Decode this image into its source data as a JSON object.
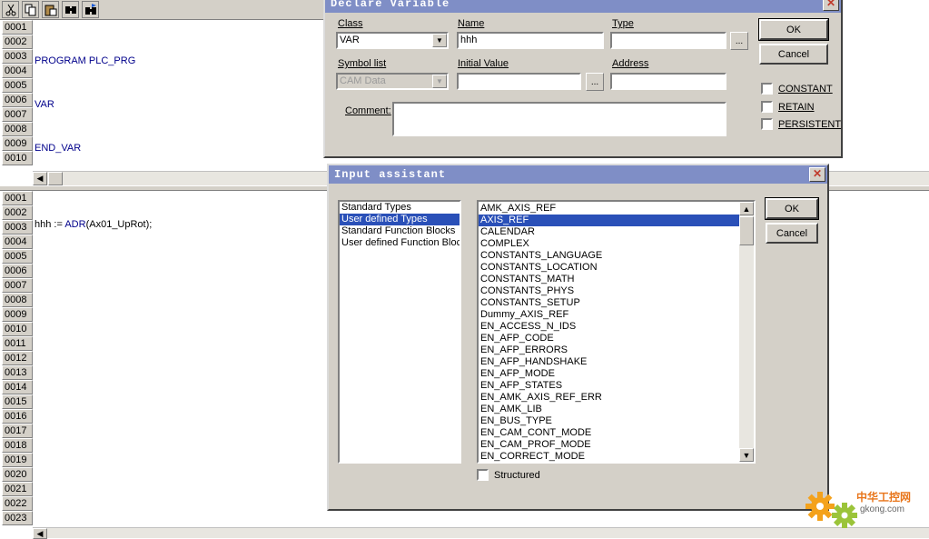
{
  "toolbar": {
    "icons": [
      "cut-icon",
      "copy-icon",
      "paste-icon",
      "find-icon",
      "find-next-icon"
    ]
  },
  "declaration": {
    "line_numbers": [
      "0001",
      "0002",
      "0003",
      "0004",
      "0005",
      "0006",
      "0007",
      "0008",
      "0009",
      "0010"
    ],
    "lines": [
      {
        "kw": "PROGRAM",
        "rest": " PLC_PRG"
      },
      {
        "kw": "VAR",
        "rest": ""
      },
      {
        "kw": "END_VAR",
        "rest": ""
      }
    ]
  },
  "body": {
    "line_numbers": [
      "0001",
      "0002",
      "0003",
      "0004",
      "0005",
      "0006",
      "0007",
      "0008",
      "0009",
      "0010",
      "0011",
      "0012",
      "0013",
      "0014",
      "0015",
      "0016",
      "0017",
      "0018",
      "0019",
      "0020",
      "0021",
      "0022",
      "0023"
    ],
    "code_pre": "hhh := ",
    "code_fn": "ADR",
    "code_post": "(Ax01_UpRot);"
  },
  "declare_dialog": {
    "title": "Declare Variable",
    "class_label": "Class",
    "class_value": "VAR",
    "name_label": "Name",
    "name_value": "hhh",
    "type_label": "Type",
    "type_value": "",
    "symbol_list_label": "Symbol list",
    "symbol_list_value": "CAM Data",
    "initial_value_label": "Initial Value",
    "initial_value": "",
    "address_label": "Address",
    "address_value": "",
    "comment_label": "Comment:",
    "comment_value": "",
    "browse_label": "...",
    "ok_label": "OK",
    "cancel_label": "Cancel",
    "constant_label": "CONSTANT",
    "retain_label": "RETAIN",
    "persistent_label": "PERSISTENT"
  },
  "input_assistant": {
    "title": "Input assistant",
    "categories": [
      "Standard Types",
      "User defined Types",
      "Standard Function Blocks",
      "User defined Function Bloc"
    ],
    "selected_category": 1,
    "types": [
      "AMK_AXIS_REF",
      "AXIS_REF",
      "CALENDAR",
      "COMPLEX",
      "CONSTANTS_LANGUAGE",
      "CONSTANTS_LOCATION",
      "CONSTANTS_MATH",
      "CONSTANTS_PHYS",
      "CONSTANTS_SETUP",
      "Dummy_AXIS_REF",
      "EN_ACCESS_N_IDS",
      "EN_AFP_CODE",
      "EN_AFP_ERRORS",
      "EN_AFP_HANDSHAKE",
      "EN_AFP_MODE",
      "EN_AFP_STATES",
      "EN_AMK_AXIS_REF_ERR",
      "EN_AMK_LIB",
      "EN_BUS_TYPE",
      "EN_CAM_CONT_MODE",
      "EN_CAM_PROF_MODE",
      "EN_CORRECT_MODE"
    ],
    "selected_type": 1,
    "structured_label": "Structured",
    "ok_label": "OK",
    "cancel_label": "Cancel"
  },
  "watermark": {
    "brand": "中华工控网",
    "url": "gkong.com"
  }
}
